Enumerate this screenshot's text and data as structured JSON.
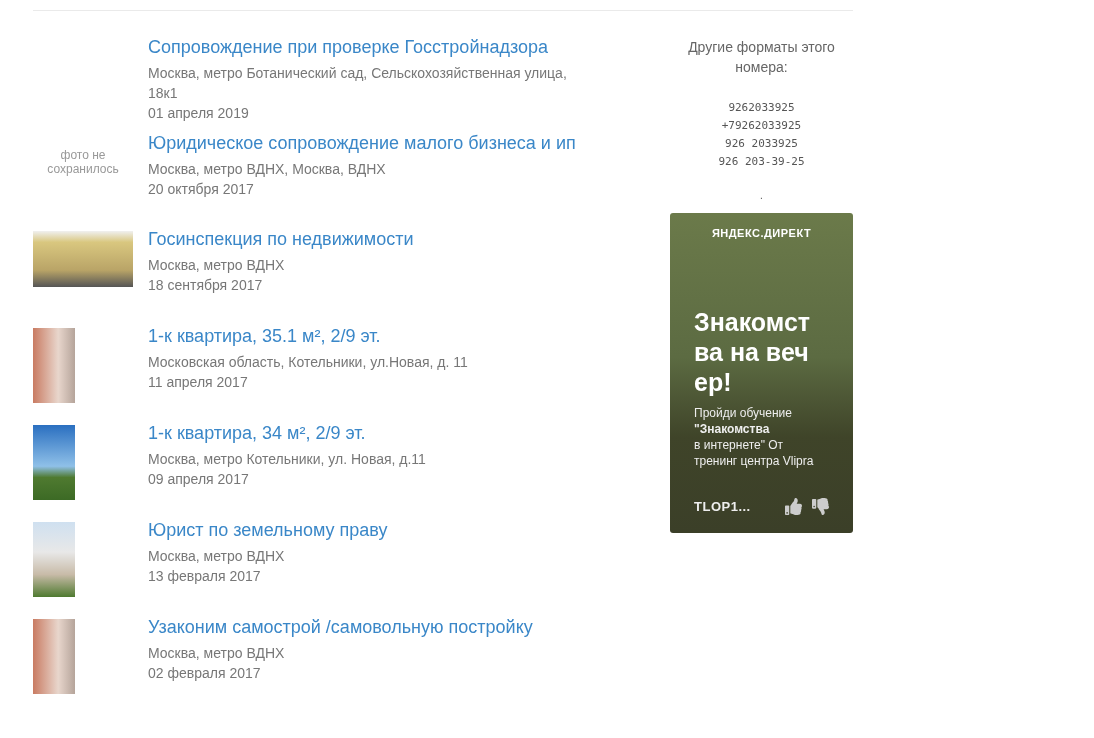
{
  "listings": [
    {
      "title": "Сопровождение при проверке Госстройнадзора",
      "address": "Москва, метро Ботанический сад, Сельскохозяйственная улица, 18к1",
      "date": "01 апреля 2019",
      "thumb": {
        "kind": "empty"
      }
    },
    {
      "title": "Юридическое сопровождение малого бизнеса и ип",
      "address": "Москва, метро ВДНХ, Москва, ВДНХ",
      "date": "20 октября 2017",
      "thumb": {
        "kind": "missing",
        "text": "фото не сохранилось"
      }
    },
    {
      "title": "Госинспекция по недвижимости",
      "address": "Москва, метро ВДНХ",
      "date": "18 сентября 2017",
      "thumb": {
        "kind": "wide"
      }
    },
    {
      "title": "1-к квартира, 35.1 м², 2/9 эт.",
      "address": "Московская область, Котельники, ул.Новая, д. 11",
      "date": "11 апреля 2017",
      "thumb": {
        "kind": "tall"
      }
    },
    {
      "title": "1-к квартира, 34 м², 2/9 эт.",
      "address": "Москва, метро Котельники, ул. Новая, д.11",
      "date": "09 апреля 2017",
      "thumb": {
        "kind": "tall"
      }
    },
    {
      "title": "Юрист по земельному праву",
      "address": "Москва, метро ВДНХ",
      "date": "13 февраля 2017",
      "thumb": {
        "kind": "tall"
      }
    },
    {
      "title": "Узаконим самострой /самовольную постройку",
      "address": "Москва, метро ВДНХ",
      "date": "02 февраля 2017",
      "thumb": {
        "kind": "tall"
      }
    }
  ],
  "sidebar": {
    "formats_title": "Другие форматы этого номера:",
    "formats": [
      "9262033925",
      "+79262033925",
      "926 2033925",
      "926 203-39-25"
    ],
    "dot": ".",
    "ad": {
      "label": "ЯНДЕКС.ДИРЕКТ",
      "headline": "Знакомства на вечер!",
      "body": "Пройди обучение **\"Знакомства**\nв интернете\" От тренинг центра Vlipra",
      "domain": "TLOP1..."
    }
  }
}
